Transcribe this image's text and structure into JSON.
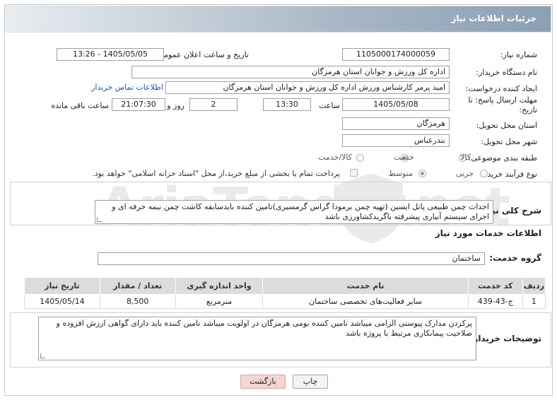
{
  "header": {
    "title": "جزئیات اطلاعات نیاز"
  },
  "fields": {
    "need_number_label": "شماره نیاز:",
    "need_number": "1105000174000059",
    "announce_label": "تاریخ و ساعت اعلان عمومی:",
    "announce_value": "1405/05/05 - 13:26",
    "buyer_org_label": "نام دستگاه خریدار:",
    "buyer_org": "اداره کل ورزش و جوانان استان هرمزگان",
    "requester_label": "ایجاد کننده درخواست:",
    "requester": "امید پرمر کارشناس ورزش اداره کل ورزش و جوانان استان هرمزگان",
    "contact_link": "اطلاعات تماس خریدار",
    "deadline_label_1": "مهلت ارسال پاسخ: تا",
    "deadline_label_2": "تاریخ:",
    "deadline_date": "1405/05/08",
    "time_label": "ساعت",
    "deadline_time": "13:30",
    "days_value": "2",
    "days_label": "روز و",
    "remaining_value": "21:07:30",
    "remaining_label": "ساعت باقی مانده",
    "province_label": "استان محل تحویل:",
    "province": "هرمزگان",
    "city_label": "شهر محل تحویل:",
    "city": "بندرعباس",
    "category_label": "طبقه بندی موضوعی:",
    "category_options": [
      "کالا",
      "خدمت",
      "کالا/خدمت"
    ],
    "category_selected": "خدمت",
    "process_label": "نوع فرآیند خرید :",
    "process_options": [
      "جزیی",
      "متوسط"
    ],
    "process_selected": "متوسط",
    "payment_note": "پرداخت تمام یا بخشی از مبلغ خرید،از محل \"اسناد خزانه اسلامی\" خواهد بود."
  },
  "summary": {
    "label": "شرح کلی نیاز:",
    "text": "احداث چمن طبیعی پاتل ایسین (تهیه چمن برمودا گراس گرمسیری)تامین کننده باید‌سابقه کاشت چمن نیمه حرفه ای و اجرای سیستم آبیاری پیشرفته باگریدکشاورزی باشد"
  },
  "services": {
    "heading": "اطلاعات خدمات مورد نیاز",
    "group_label": "گروه خدمت:",
    "group_value": "ساختمان",
    "columns": [
      "ردیف",
      "کد خدمت",
      "نام خدمت",
      "واحد اندازه گیری",
      "تعداد / مقدار",
      "تاریخ نیاز"
    ],
    "rows": [
      [
        "1",
        "ج-43-439",
        "سایر فعالیت‌های تخصصی ساختمان",
        "مترمربع",
        "8,500",
        "1405/05/14"
      ]
    ]
  },
  "buyer_notes": {
    "label": "توضیحات خریدار:",
    "text": "پرکردن مدارک پیوستی الزامی میباشد تامین کننده بومی هرمزگان در اولویت میباشد تامین کننده باید دارای گواهی ارزش افزوده و صلاحیت پیمانکاری مرتبط با پروژه باشد"
  },
  "buttons": {
    "print": "چاپ",
    "back": "بازگشت"
  },
  "watermark": "AriaTender.net",
  "colors": {
    "link": "#1a56b8",
    "header_gradient": "#8ba0b4",
    "back_button": "#f6d4d4"
  }
}
